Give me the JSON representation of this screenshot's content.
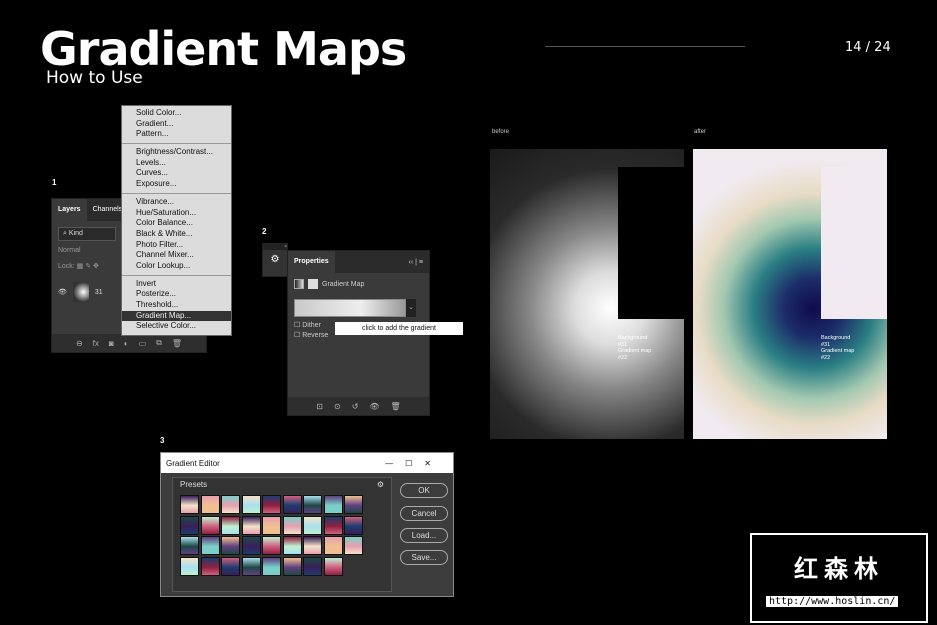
{
  "header": {
    "title": "Gradient Maps",
    "subtitle": "How to Use",
    "page": "14 / 24"
  },
  "steps": [
    "1",
    "2",
    "3"
  ],
  "layers_panel": {
    "tabs": [
      "Layers",
      "Channels"
    ],
    "kind": "Kind",
    "blend": "Normal",
    "lock": "Lock:",
    "layer_name": "31"
  },
  "adjust_menu": {
    "groups": [
      [
        "Solid Color...",
        "Gradient...",
        "Pattern..."
      ],
      [
        "Brightness/Contrast...",
        "Levels...",
        "Curves...",
        "Exposure..."
      ],
      [
        "Vibrance...",
        "Hue/Saturation...",
        "Color Balance...",
        "Black & White...",
        "Photo Filter...",
        "Channel Mixer...",
        "Color Lookup..."
      ],
      [
        "Invert",
        "Posterize...",
        "Threshold...",
        "Gradient Map...",
        "Selective Color..."
      ]
    ],
    "selected": "Gradient Map..."
  },
  "properties": {
    "title": "Properties",
    "subtitle": "Gradient Map",
    "dither": "Dither",
    "reverse": "Reverse",
    "callout": "click to add the gradient"
  },
  "gradient_editor": {
    "title": "Gradient Editor",
    "presets": "Presets",
    "buttons": [
      "OK",
      "Cancel",
      "Load...",
      "Save..."
    ]
  },
  "comparison": {
    "before": "before",
    "after": "after",
    "caption": [
      "Background",
      "#31",
      "Gradient map",
      "#22"
    ]
  },
  "watermark": {
    "cn": "红森林",
    "url": "http://www.hoslin.cn/"
  }
}
